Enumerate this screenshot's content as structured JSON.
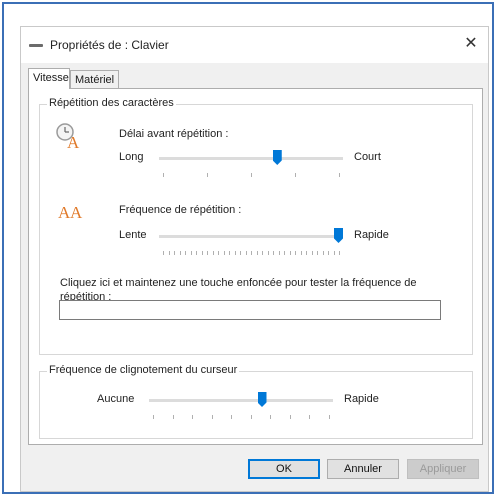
{
  "window": {
    "title": "Propriétés de : Clavier",
    "close_glyph": "✕"
  },
  "tabs": [
    {
      "label": "Vitesse",
      "active": true
    },
    {
      "label": "Matériel",
      "active": false
    }
  ],
  "repeat_group": {
    "title": "Répétition des caractères",
    "delay": {
      "label": "Délai avant répétition :",
      "min_label": "Long",
      "max_label": "Court",
      "icon": "repeat-delay-icon",
      "value": 0.65
    },
    "rate": {
      "label": "Fréquence de répétition :",
      "min_label": "Lente",
      "max_label": "Rapide",
      "icon": "repeat-rate-icon",
      "value": 1.0
    },
    "test_instructions": "Cliquez ici et maintenez une touche enfoncée pour tester la fréquence de répétition :",
    "test_value": ""
  },
  "cursor_group": {
    "title": "Fréquence de clignotement du curseur",
    "min_label": "Aucune",
    "max_label": "Rapide",
    "value": 0.62
  },
  "buttons": {
    "ok": "OK",
    "cancel": "Annuler",
    "apply": "Appliquer"
  },
  "colors": {
    "accent": "#0078d7",
    "frame": "#3b6fb6"
  }
}
